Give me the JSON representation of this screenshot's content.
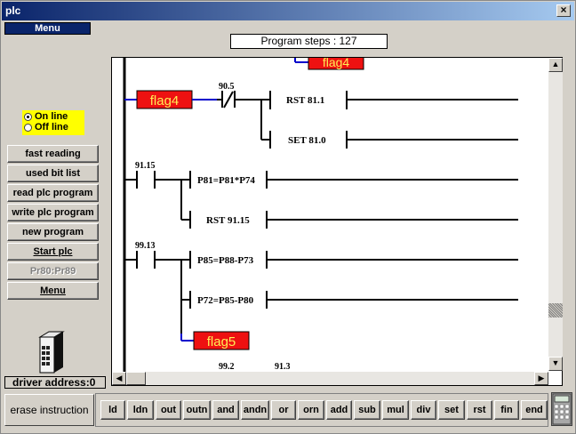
{
  "window": {
    "title": "plc",
    "close_glyph": "×"
  },
  "menu_label": "Menu",
  "program_steps": "Program steps : 127",
  "connection": {
    "options": [
      "On line",
      "Off line"
    ],
    "selected": "On line"
  },
  "side_buttons": [
    "fast reading",
    "used bit list",
    "read plc program",
    "write plc program",
    "new program",
    "Start plc",
    "Pr80:Pr89",
    "Menu"
  ],
  "driver_address": "driver address:0",
  "ladder": {
    "flags": [
      "flag4",
      "flag4",
      "flag5"
    ],
    "contacts": [
      "90.5",
      "91.15",
      "99.13"
    ],
    "instructions": [
      "RST 81.1",
      "SET 81.0",
      "P81=P81*P74",
      "RST 91.15",
      "P85=P88-P73",
      "P72=P85-P80"
    ],
    "bottom_labels": [
      "99.2",
      "91.3"
    ]
  },
  "erase_instruction_label": "erase instruction",
  "instruction_buttons": [
    "ld",
    "ldn",
    "out",
    "outn",
    "and",
    "andn",
    "or",
    "orn",
    "add",
    "sub",
    "mul",
    "div",
    "set",
    "rst",
    "fin",
    "end"
  ],
  "colors": {
    "flag_fill": "#ee1111",
    "flag_text": "#ffee55",
    "flag_link": "#0000cc",
    "highlight": "#ffff00"
  },
  "icons": {
    "close": "close-icon",
    "device": "plc-device-icon",
    "calculator": "calculator-icon",
    "scroll_up": "arrow-up-icon",
    "scroll_down": "arrow-down-icon",
    "scroll_left": "arrow-left-icon",
    "scroll_right": "arrow-right-icon"
  }
}
